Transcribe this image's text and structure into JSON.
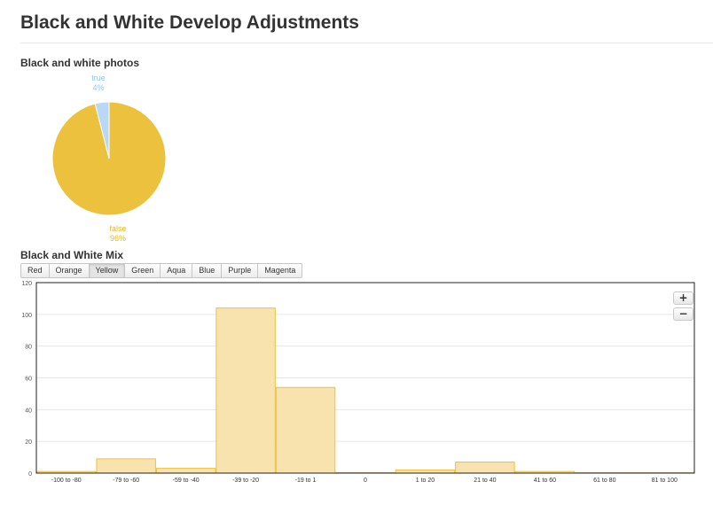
{
  "page": {
    "title": "Black and White Develop Adjustments"
  },
  "sections": {
    "photos_title": "Black and white photos",
    "mix_title": "Black and White Mix"
  },
  "tabs": [
    "Red",
    "Orange",
    "Yellow",
    "Green",
    "Aqua",
    "Blue",
    "Purple",
    "Magenta"
  ],
  "active_tab": "Yellow",
  "zoom": {
    "in_label": "+",
    "out_label": "−"
  },
  "colors": {
    "accent": "#ecc13d",
    "bar_fill": "#f8e3ae",
    "pie_true": "#b8d8f5",
    "pie_true_label": "#8fc3ec",
    "pie_false_label": "#e3b72e"
  },
  "chart_data": [
    {
      "type": "pie",
      "title": "Black and white photos",
      "slices": [
        {
          "label": "true",
          "value": 4,
          "pct_label": "4%",
          "color": "#b8d8f5"
        },
        {
          "label": "false",
          "value": 96,
          "pct_label": "96%",
          "color": "#ecc13d"
        }
      ]
    },
    {
      "type": "bar",
      "title": "Black and White Mix",
      "categories": [
        "-100 to -80",
        "-79 to -60",
        "-59 to -40",
        "-39 to -20",
        "-19 to 1",
        "0",
        "1 to 20",
        "21 to 40",
        "41 to 60",
        "61 to 80",
        "81 to 100"
      ],
      "values": [
        1,
        9,
        3,
        104,
        54,
        0,
        2,
        7,
        1,
        0,
        0
      ],
      "ylim": [
        0,
        120
      ],
      "yticks": [
        0,
        20,
        40,
        60,
        80,
        100,
        120
      ],
      "grid": true,
      "xlabel": "",
      "ylabel": ""
    }
  ]
}
